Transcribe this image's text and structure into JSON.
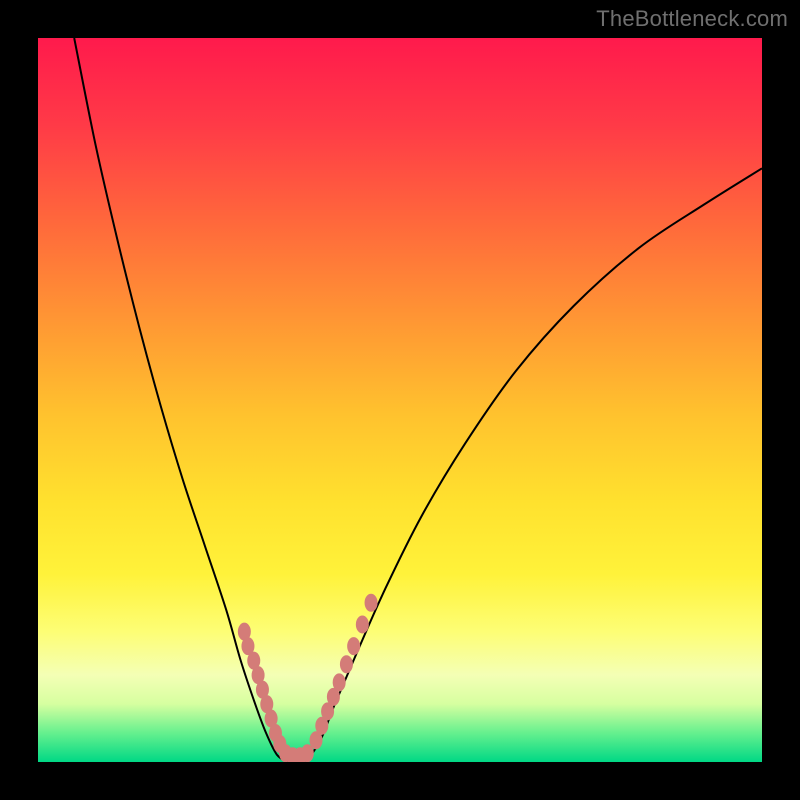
{
  "watermark": "TheBottleneck.com",
  "colors": {
    "frame": "#000000",
    "curve": "#000000",
    "dot": "#d47c78",
    "gradient_top": "#ff1a4c",
    "gradient_bottom": "#00d885"
  },
  "chart_data": {
    "type": "line",
    "title": "",
    "xlabel": "",
    "ylabel": "",
    "xlim": [
      0,
      100
    ],
    "ylim": [
      0,
      100
    ],
    "note": "No axis tick labels shown; coordinates below are read in percent of plot area. y=100 is top (red), y=0 is bottom (green).",
    "series": [
      {
        "name": "left-curve",
        "x": [
          5,
          8,
          11,
          14,
          17,
          20,
          23,
          26,
          28,
          30,
          31.5,
          33,
          34.5
        ],
        "y": [
          100,
          85,
          72,
          60,
          49,
          39,
          30,
          21,
          14,
          8,
          4,
          1,
          0
        ]
      },
      {
        "name": "right-curve",
        "x": [
          37,
          39,
          41,
          44,
          48,
          53,
          59,
          66,
          74,
          83,
          92,
          100
        ],
        "y": [
          0,
          3,
          8,
          15,
          24,
          34,
          44,
          54,
          63,
          71,
          77,
          82
        ]
      }
    ],
    "marker_clusters": [
      {
        "name": "left-dots",
        "points": [
          {
            "x": 28.5,
            "y": 18
          },
          {
            "x": 29.0,
            "y": 16
          },
          {
            "x": 29.8,
            "y": 14
          },
          {
            "x": 30.4,
            "y": 12
          },
          {
            "x": 31.0,
            "y": 10
          },
          {
            "x": 31.6,
            "y": 8
          },
          {
            "x": 32.2,
            "y": 6
          },
          {
            "x": 32.8,
            "y": 4
          },
          {
            "x": 33.4,
            "y": 2.5
          }
        ]
      },
      {
        "name": "bottom-dots",
        "points": [
          {
            "x": 34.2,
            "y": 1.2
          },
          {
            "x": 35.2,
            "y": 0.8
          },
          {
            "x": 36.2,
            "y": 0.8
          },
          {
            "x": 37.2,
            "y": 1.2
          }
        ]
      },
      {
        "name": "right-dots",
        "points": [
          {
            "x": 38.4,
            "y": 3
          },
          {
            "x": 39.2,
            "y": 5
          },
          {
            "x": 40.0,
            "y": 7
          },
          {
            "x": 40.8,
            "y": 9
          },
          {
            "x": 41.6,
            "y": 11
          },
          {
            "x": 42.6,
            "y": 13.5
          },
          {
            "x": 43.6,
            "y": 16
          },
          {
            "x": 44.8,
            "y": 19
          },
          {
            "x": 46.0,
            "y": 22
          }
        ]
      }
    ]
  }
}
